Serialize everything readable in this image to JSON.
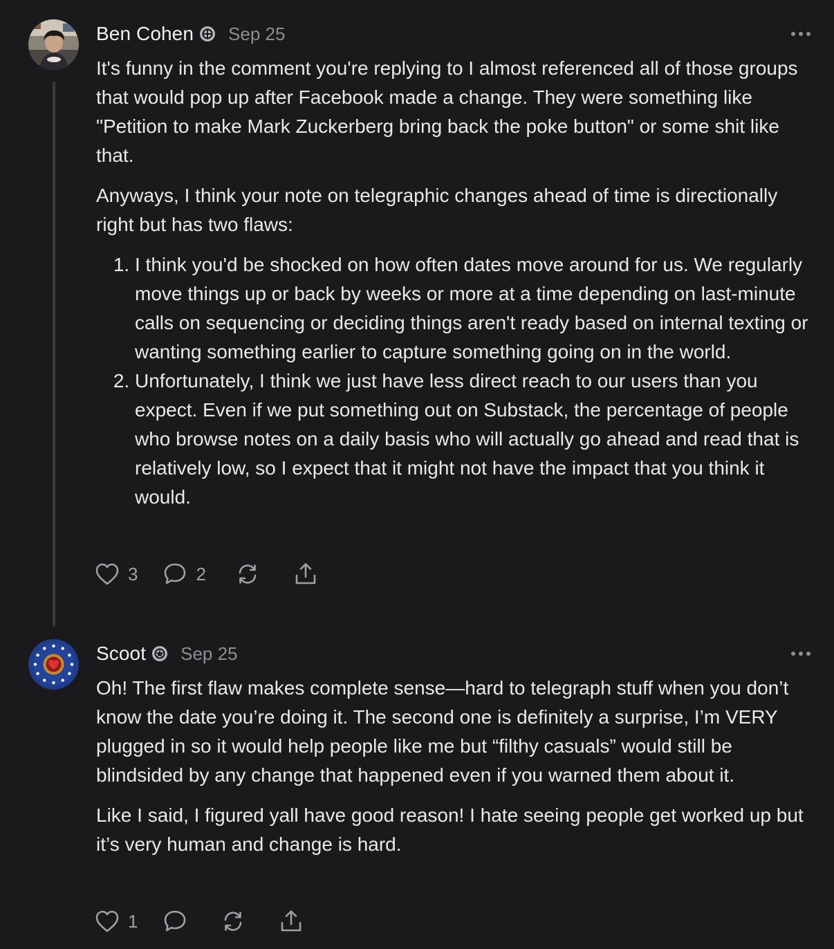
{
  "comments": [
    {
      "author": "Ben Cohen",
      "date": "Sep 25",
      "paragraphs": [
        "It's funny in the comment you're replying to I almost referenced all of those groups that would pop up after Facebook made a change. They were something like \"Petition to make Mark Zuckerberg bring back the poke button\" or some shit like that.",
        "Anyways, I think your note on telegraphic changes ahead of time is directionally right but has two flaws:"
      ],
      "list": [
        "I think you'd be shocked on how often dates move around for us. We regularly move things up or back by weeks or more at a time depending on last-minute calls on sequencing or deciding things aren't ready based on internal texting or wanting something earlier to capture something going on in the world.",
        "Unfortunately, I think we just have less direct reach to our users than you expect. Even if we put something out on Substack, the percentage of people who browse notes on a daily basis who will actually go ahead and read that is relatively low, so I expect that it might not have the impact that you think it would."
      ],
      "likes": "3",
      "replies": "2"
    },
    {
      "author": "Scoot",
      "date": "Sep 25",
      "paragraphs": [
        "Oh! The first flaw makes complete sense—hard to telegraph stuff when you don’t know the date you’re doing it. The second one is definitely a surprise, I’m VERY plugged in so it would help people like me but “filthy casuals” would still be blindsided by any change that happened even if you warned them about it.",
        "Like I said, I figured yall have good reason! I hate seeing people get worked up but it’s very human and change is hard."
      ],
      "likes": "1"
    }
  ],
  "colors": {
    "background": "#1a1a1c",
    "text": "#e9e9ec",
    "muted": "#8e8e93",
    "thread_line": "#3c3c40"
  },
  "icons": [
    "heart-icon",
    "comment-icon",
    "restack-icon",
    "share-icon",
    "more-icon",
    "verified-badge-icon"
  ]
}
